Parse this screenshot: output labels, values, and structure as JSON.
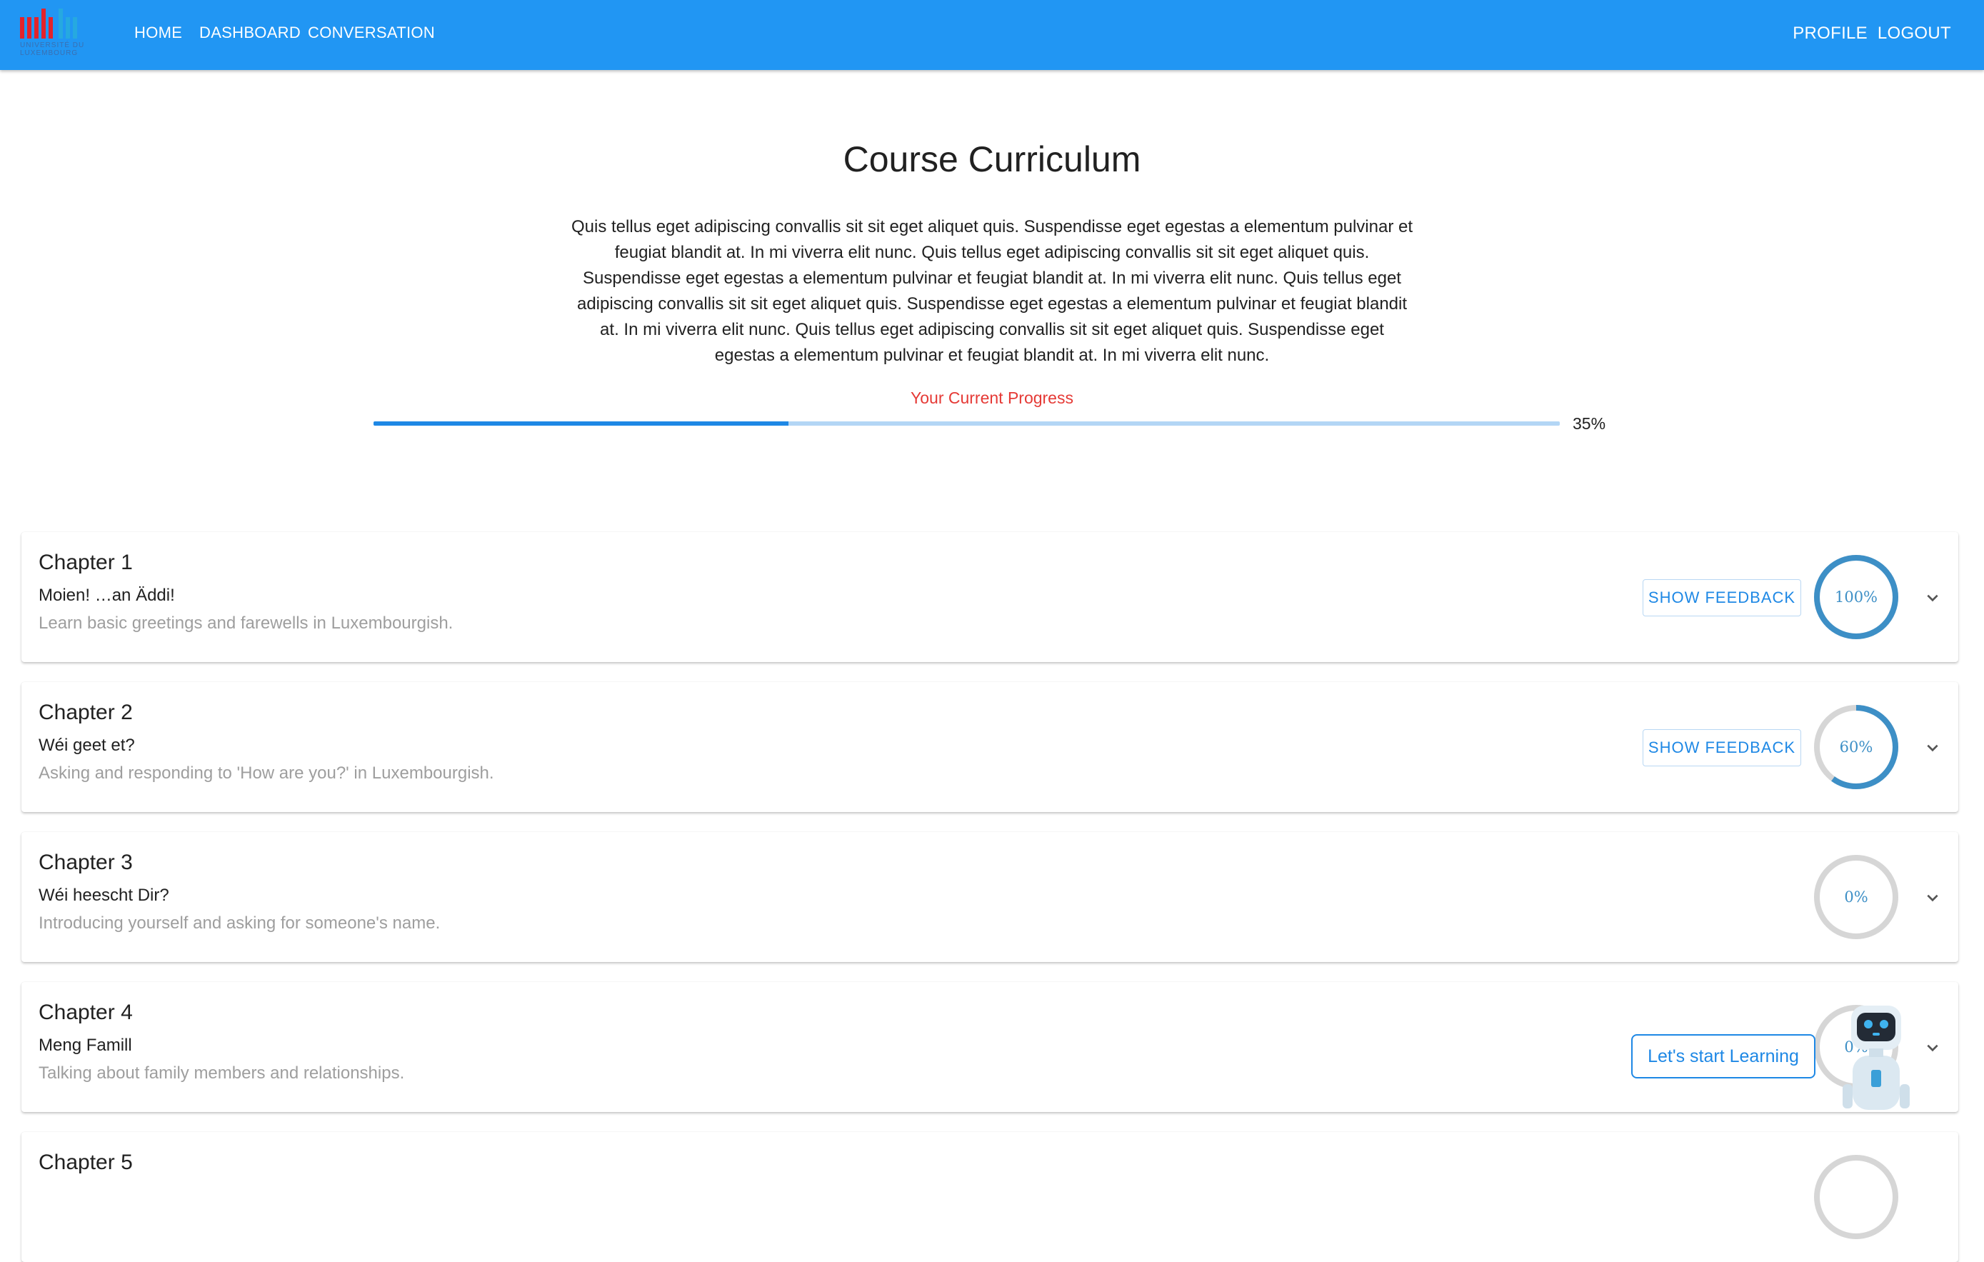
{
  "nav": {
    "logo_line1": "Université du",
    "logo_line2": "Luxembourg",
    "links": [
      "HOME",
      "DASHBOARD",
      "CONVERSATION"
    ],
    "profile": "PROFILE",
    "logout": "LOGOUT"
  },
  "colors": {
    "appbar": "#2196f3",
    "accent": "#1e88e5",
    "progress_label": "#e53935",
    "ring_track": "#d6d6d6",
    "ring_fill": "#3d8fc6"
  },
  "page": {
    "title": "Course Curriculum",
    "intro": "Quis tellus eget adipiscing convallis sit sit eget aliquet quis. Suspendisse eget egestas a elementum pulvinar et feugiat blandit at. In mi viverra elit nunc. Quis tellus eget adipiscing convallis sit sit eget aliquet quis. Suspendisse eget egestas a elementum pulvinar et feugiat blandit at. In mi viverra elit nunc. Quis tellus eget adipiscing convallis sit sit eget aliquet quis. Suspendisse eget egestas a elementum pulvinar et feugiat blandit at. In mi viverra elit nunc. Quis tellus eget adipiscing convallis sit sit eget aliquet quis. Suspendisse eget egestas a elementum pulvinar et feugiat blandit at. In mi viverra elit nunc.",
    "progress_label": "Your Current Progress",
    "progress_percent": 35,
    "progress_text": "35%"
  },
  "chapters": [
    {
      "title": "Chapter 1",
      "subtitle": "Moien! …an Äddi!",
      "description": "Learn basic greetings and farewells in Luxembourgish.",
      "feedback_label": "SHOW FEEDBACK",
      "progress": 100,
      "progress_text": "100%"
    },
    {
      "title": "Chapter 2",
      "subtitle": "Wéi geet et?",
      "description": "Asking and responding to 'How are you?' in Luxembourgish.",
      "feedback_label": "SHOW FEEDBACK",
      "progress": 60,
      "progress_text": "60%"
    },
    {
      "title": "Chapter 3",
      "subtitle": "Wéi heescht Dir?",
      "description": "Introducing yourself and asking for someone's name.",
      "feedback_label": "",
      "progress": 0,
      "progress_text": "0%"
    },
    {
      "title": "Chapter 4",
      "subtitle": "Meng Famill",
      "description": "Talking about family members and relationships.",
      "feedback_label": "",
      "progress": 0,
      "progress_text": "0%"
    },
    {
      "title": "Chapter 5",
      "subtitle": "",
      "description": "",
      "feedback_label": "",
      "progress": 0,
      "progress_text": ""
    }
  ],
  "assistant": {
    "button_label": "Let's start Learning",
    "icon": "robot-icon"
  }
}
